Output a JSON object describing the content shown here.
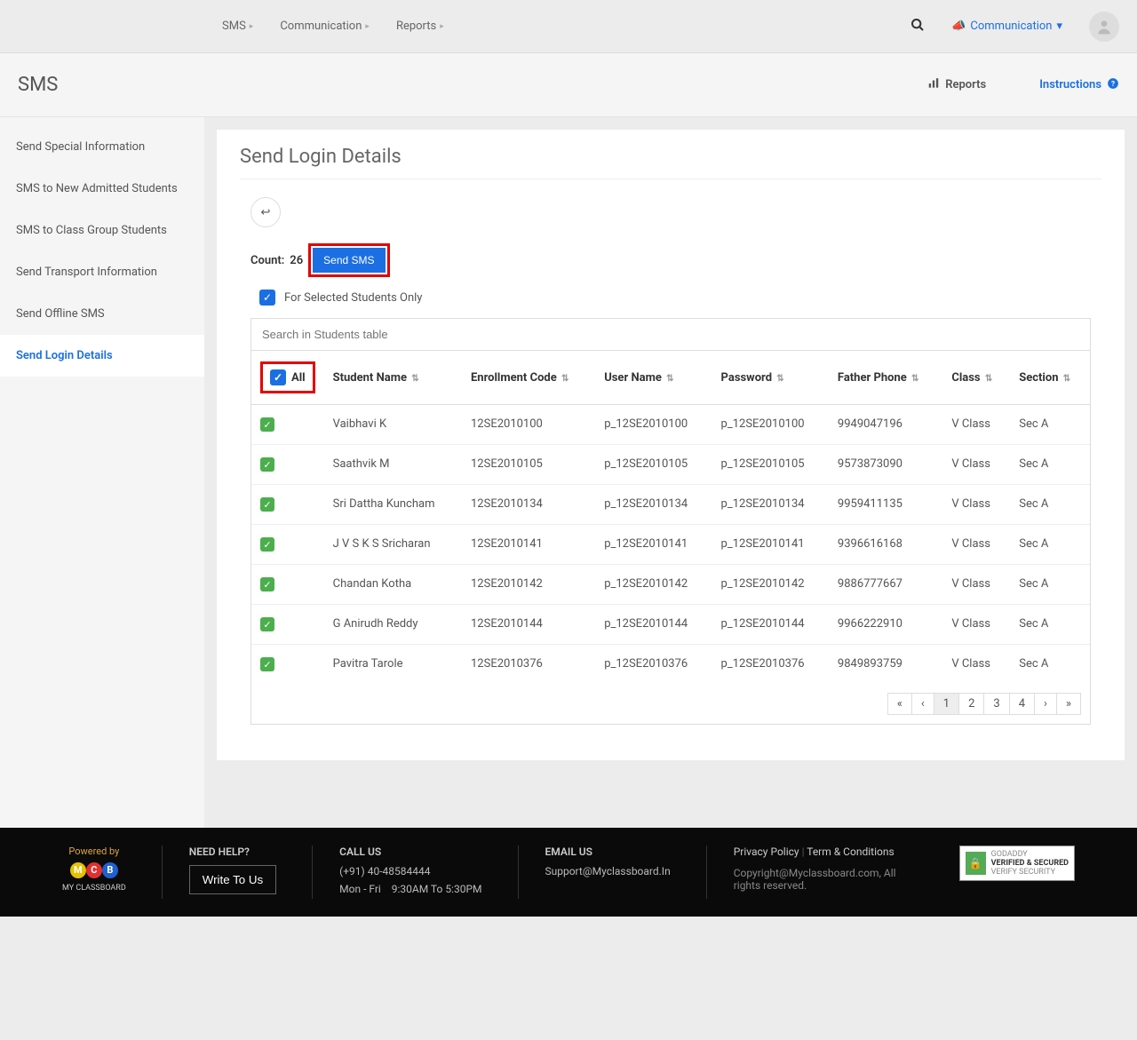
{
  "topnav": {
    "crumbs": [
      "SMS",
      "Communication",
      "Reports"
    ],
    "comm_label": "Communication"
  },
  "subheader": {
    "title": "SMS",
    "reports": "Reports",
    "instructions": "Instructions"
  },
  "sidebar": {
    "items": [
      {
        "label": "Send Special Information",
        "active": false
      },
      {
        "label": "SMS to New Admitted Students",
        "active": false
      },
      {
        "label": "SMS to Class Group Students",
        "active": false
      },
      {
        "label": "Send Transport Information",
        "active": false
      },
      {
        "label": "Send Offline SMS",
        "active": false
      },
      {
        "label": "Send Login Details",
        "active": true
      }
    ]
  },
  "page": {
    "title": "Send Login Details",
    "count_label": "Count:",
    "count_value": "26",
    "send_sms": "Send SMS",
    "selected_only": "For Selected Students Only",
    "search_placeholder": "Search in Students table",
    "all_label": "All"
  },
  "columns": [
    "Student Name",
    "Enrollment Code",
    "User Name",
    "Password",
    "Father Phone",
    "Class",
    "Section"
  ],
  "rows": [
    {
      "name": "Vaibhavi K",
      "code": "12SE2010100",
      "user": "p_12SE2010100",
      "pass": "p_12SE2010100",
      "phone": "9949047196",
      "class": "V Class",
      "section": "Sec A"
    },
    {
      "name": "Saathvik M",
      "code": "12SE2010105",
      "user": "p_12SE2010105",
      "pass": "p_12SE2010105",
      "phone": "9573873090",
      "class": "V Class",
      "section": "Sec A"
    },
    {
      "name": "Sri Dattha Kuncham",
      "code": "12SE2010134",
      "user": "p_12SE2010134",
      "pass": "p_12SE2010134",
      "phone": "9959411135",
      "class": "V Class",
      "section": "Sec A"
    },
    {
      "name": "J V S K S Sricharan",
      "code": "12SE2010141",
      "user": "p_12SE2010141",
      "pass": "p_12SE2010141",
      "phone": "9396616168",
      "class": "V Class",
      "section": "Sec A"
    },
    {
      "name": "Chandan Kotha",
      "code": "12SE2010142",
      "user": "p_12SE2010142",
      "pass": "p_12SE2010142",
      "phone": "9886777667",
      "class": "V Class",
      "section": "Sec A"
    },
    {
      "name": "G Anirudh Reddy",
      "code": "12SE2010144",
      "user": "p_12SE2010144",
      "pass": "p_12SE2010144",
      "phone": "9966222910",
      "class": "V Class",
      "section": "Sec A"
    },
    {
      "name": "Pavitra Tarole",
      "code": "12SE2010376",
      "user": "p_12SE2010376",
      "pass": "p_12SE2010376",
      "phone": "9849893759",
      "class": "V Class",
      "section": "Sec A"
    }
  ],
  "pager": [
    "«",
    "‹",
    "1",
    "2",
    "3",
    "4",
    "›",
    "»"
  ],
  "footer": {
    "powered": "Powered by",
    "brand": "MY CLASSBOARD",
    "help_title": "NEED HELP?",
    "write": "Write To Us",
    "call_title": "CALL US",
    "phone": "(+91) 40-48584444",
    "hours": "Mon - Fri    9:30AM To 5:30PM",
    "email_title": "EMAIL US",
    "email": "Support@Myclassboard.In",
    "privacy": "Privacy Policy",
    "terms": "Term & Conditions",
    "copyright": "Copyright@Myclassboard.com, All rights reserved.",
    "badge1": "GODADDY",
    "badge2": "VERIFIED & SECURED",
    "badge3": "VERIFY SECURITY"
  }
}
